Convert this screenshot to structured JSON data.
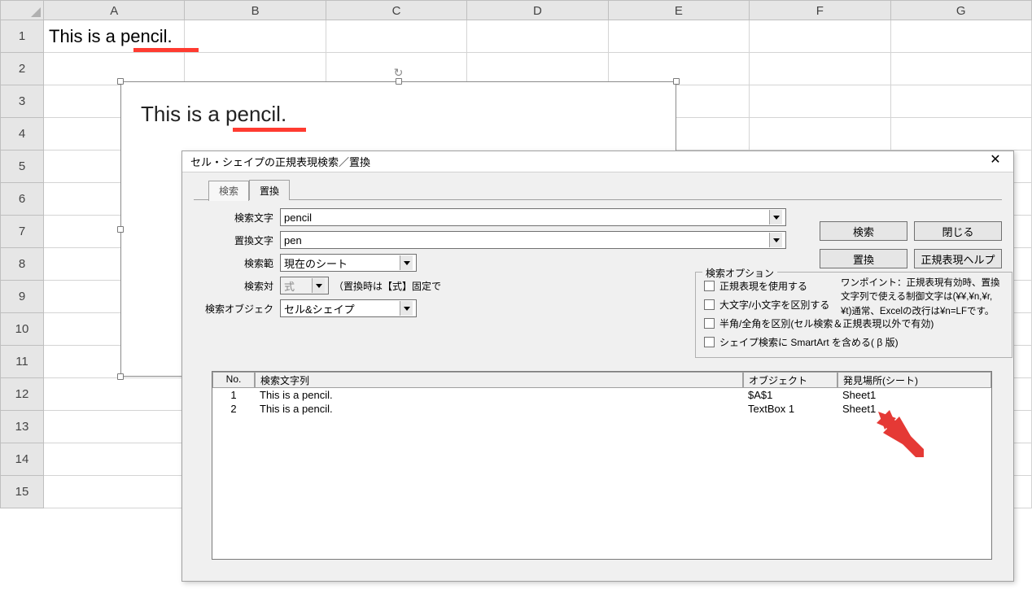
{
  "grid": {
    "columns": [
      "A",
      "B",
      "C",
      "D",
      "E",
      "F",
      "G"
    ],
    "rows": [
      "1",
      "2",
      "3",
      "4",
      "5",
      "6",
      "7",
      "8",
      "9",
      "10",
      "11",
      "12",
      "13",
      "14",
      "15"
    ],
    "a1_text": "This is a pencil."
  },
  "textbox": {
    "text": "This is a pencil."
  },
  "dialog": {
    "title": "セル・シェイプの正規表現検索／置換",
    "tabs": {
      "search": "検索",
      "replace": "置換"
    },
    "labels": {
      "search_string": "検索文字",
      "replace_string": "置換文字",
      "search_range": "検索範",
      "search_target": "検索対",
      "search_object": "検索オブジェク"
    },
    "values": {
      "search_string": "pencil",
      "replace_string": "pen",
      "search_range": "現在のシート",
      "search_target": "式",
      "target_note": "（置換時は【式】固定で",
      "search_object": "セル&シェイプ"
    },
    "options": {
      "group_title": "検索オプション",
      "use_regex": "正規表現を使用する",
      "case_sensitive": "大文字/小文字を区別する",
      "half_full": "半角/全角を区別(セル検索＆正規表現以外で有効)",
      "include_smartart": "シェイプ検索に SmartArt を含める( β 版)"
    },
    "buttons": {
      "search": "検索",
      "close": "閉じる",
      "replace": "置換",
      "regex_help": "正規表現ヘルプ"
    },
    "hint": "ワンポイント：正規表現有効時、置換文字列で使える制御文字は(¥¥,¥n,¥r,¥t)通常、Excelの改行は¥n=LFです。",
    "results": {
      "headers": {
        "no": "No.",
        "text": "検索文字列",
        "object": "オブジェクト",
        "location": "発見場所(シート)"
      },
      "rows": [
        {
          "no": "1",
          "text": "This is a pencil.",
          "object": "$A$1",
          "location": "Sheet1"
        },
        {
          "no": "2",
          "text": "This is a pencil.",
          "object": "TextBox 1",
          "location": "Sheet1"
        }
      ]
    }
  }
}
